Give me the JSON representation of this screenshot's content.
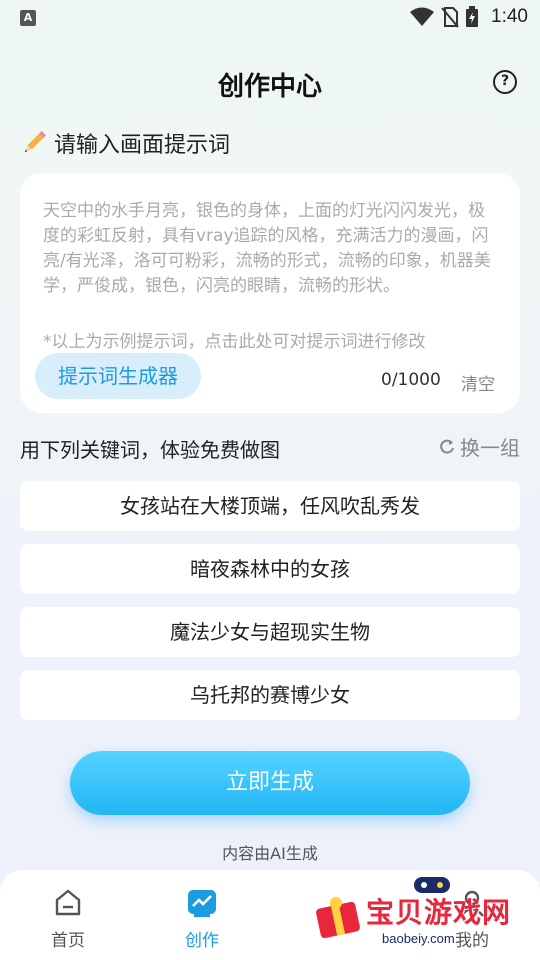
{
  "status_bar": {
    "time": "1:40",
    "app_icon_letter": "A"
  },
  "header": {
    "title": "创作中心",
    "help_glyph": "?"
  },
  "prompt": {
    "heading": "请输入画面提示词",
    "placeholder_text": "天空中的水手月亮，银色的身体，上面的灯光闪闪发光，极度的彩虹反射，具有vray追踪的风格，充满活力的漫画，闪亮/有光泽，洛可可粉彩，流畅的形式，流畅的印象，机器美学，严俊成，银色，闪亮的眼睛，流畅的形状。",
    "note": "*以上为示例提示词，点击此处可对提示词进行修改",
    "generator_button": "提示词生成器",
    "counter": "0/1000",
    "clear_label": "清空"
  },
  "keywords": {
    "heading": "用下列关键词，体验免费做图",
    "refresh_label": "换一组",
    "items": [
      "女孩站在大楼顶端，任风吹乱秀发",
      "暗夜森林中的女孩",
      "魔法少女与超现实生物",
      "乌托邦的赛博少女"
    ]
  },
  "create_button": "立即生成",
  "ai_note": "内容由AI生成",
  "tabs": [
    {
      "label": "首页",
      "icon": "home-icon"
    },
    {
      "label": "创作",
      "icon": "create-icon"
    },
    {
      "label": "我的",
      "icon": "profile-icon"
    }
  ],
  "watermark": {
    "text": "宝贝游戏网",
    "url": "baobeiy.com"
  },
  "colors": {
    "accent": "#1d9be0",
    "button_gradient_top": "#56d3ff",
    "button_gradient_bottom": "#22b5f5"
  }
}
